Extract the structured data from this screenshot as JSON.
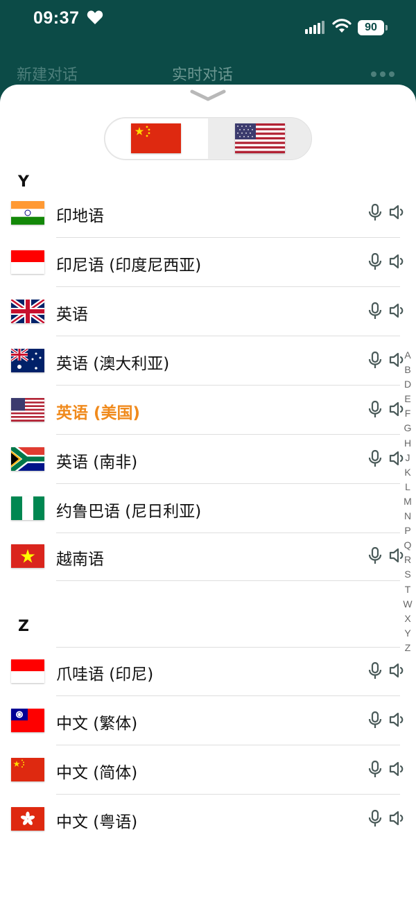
{
  "status_bar": {
    "time": "09:37",
    "battery": "90"
  },
  "header": {
    "new_chat": "新建对话",
    "live_chat": "实时对话"
  },
  "colors": {
    "header_bg": "#0c4b47",
    "selected": "#f08a1c"
  },
  "language_toggle": {
    "source": {
      "icon": "flag-china-icon"
    },
    "target": {
      "icon": "flag-usa-icon"
    }
  },
  "sections": [
    {
      "letter": "Y",
      "items": [
        {
          "label": "印地语",
          "flag": "india",
          "mic": true,
          "speaker": true
        },
        {
          "label": "印尼语 (印度尼西亚)",
          "flag": "indonesia",
          "mic": true,
          "speaker": true
        },
        {
          "label": "英语",
          "flag": "uk",
          "mic": true,
          "speaker": true
        },
        {
          "label": "英语 (澳大利亚)",
          "flag": "australia",
          "mic": true,
          "speaker": true
        },
        {
          "label": "英语 (美国)",
          "flag": "usa",
          "mic": true,
          "speaker": true,
          "selected": true
        },
        {
          "label": "英语 (南非)",
          "flag": "south-africa",
          "mic": true,
          "speaker": true
        },
        {
          "label": "约鲁巴语 (尼日利亚)",
          "flag": "nigeria",
          "mic": false,
          "speaker": false
        },
        {
          "label": "越南语",
          "flag": "vietnam",
          "mic": true,
          "speaker": true
        }
      ]
    },
    {
      "letter": "Z",
      "items": [
        {
          "label": "爪哇语 (印尼)",
          "flag": "indonesia",
          "mic": true,
          "speaker": true
        },
        {
          "label": "中文 (繁体)",
          "flag": "taiwan",
          "mic": true,
          "speaker": true
        },
        {
          "label": "中文 (简体)",
          "flag": "china",
          "mic": true,
          "speaker": true
        },
        {
          "label": "中文 (粤语)",
          "flag": "hong-kong",
          "mic": true,
          "speaker": true
        }
      ]
    }
  ],
  "index_letters": [
    "A",
    "B",
    "D",
    "E",
    "F",
    "G",
    "H",
    "J",
    "K",
    "L",
    "M",
    "N",
    "P",
    "Q",
    "R",
    "S",
    "T",
    "W",
    "X",
    "Y",
    "Z"
  ]
}
